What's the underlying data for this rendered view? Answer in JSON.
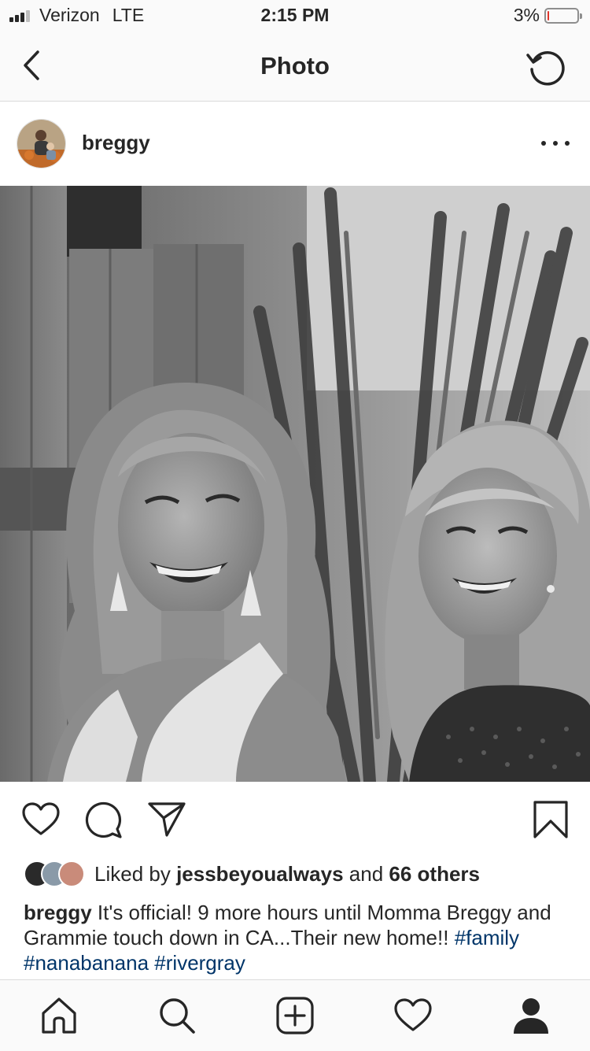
{
  "status_bar": {
    "carrier": "Verizon",
    "network": "LTE",
    "time": "2:15 PM",
    "battery": "3%",
    "battery_level": 0.03,
    "battery_color": "#e0352b"
  },
  "nav": {
    "title": "Photo",
    "back_icon": "chevron-left-icon",
    "refresh_icon": "refresh-icon"
  },
  "post": {
    "username": "breggy",
    "more_icon": "more-horizontal-icon",
    "photo_icon": "photo"
  },
  "actions": {
    "like_icon": "heart-icon",
    "comment_icon": "comment-icon",
    "share_icon": "paper-plane-icon",
    "save_icon": "bookmark-icon"
  },
  "likes": {
    "prefix": "Liked by",
    "user": "jessbeyoualways",
    "middle": "and",
    "others": "66 others"
  },
  "caption": {
    "username": "breggy",
    "text": "It's official! 9 more hours until Momma Breggy and Grammie touch down in CA...Their new home!!",
    "hashtags": [
      "#family",
      "#nanabanana",
      "#rivergray"
    ],
    "hashtag_color": "#003569"
  },
  "tabbar": {
    "items": [
      "home-icon",
      "search-icon",
      "add-post-icon",
      "activity-heart-icon",
      "profile-icon"
    ]
  }
}
